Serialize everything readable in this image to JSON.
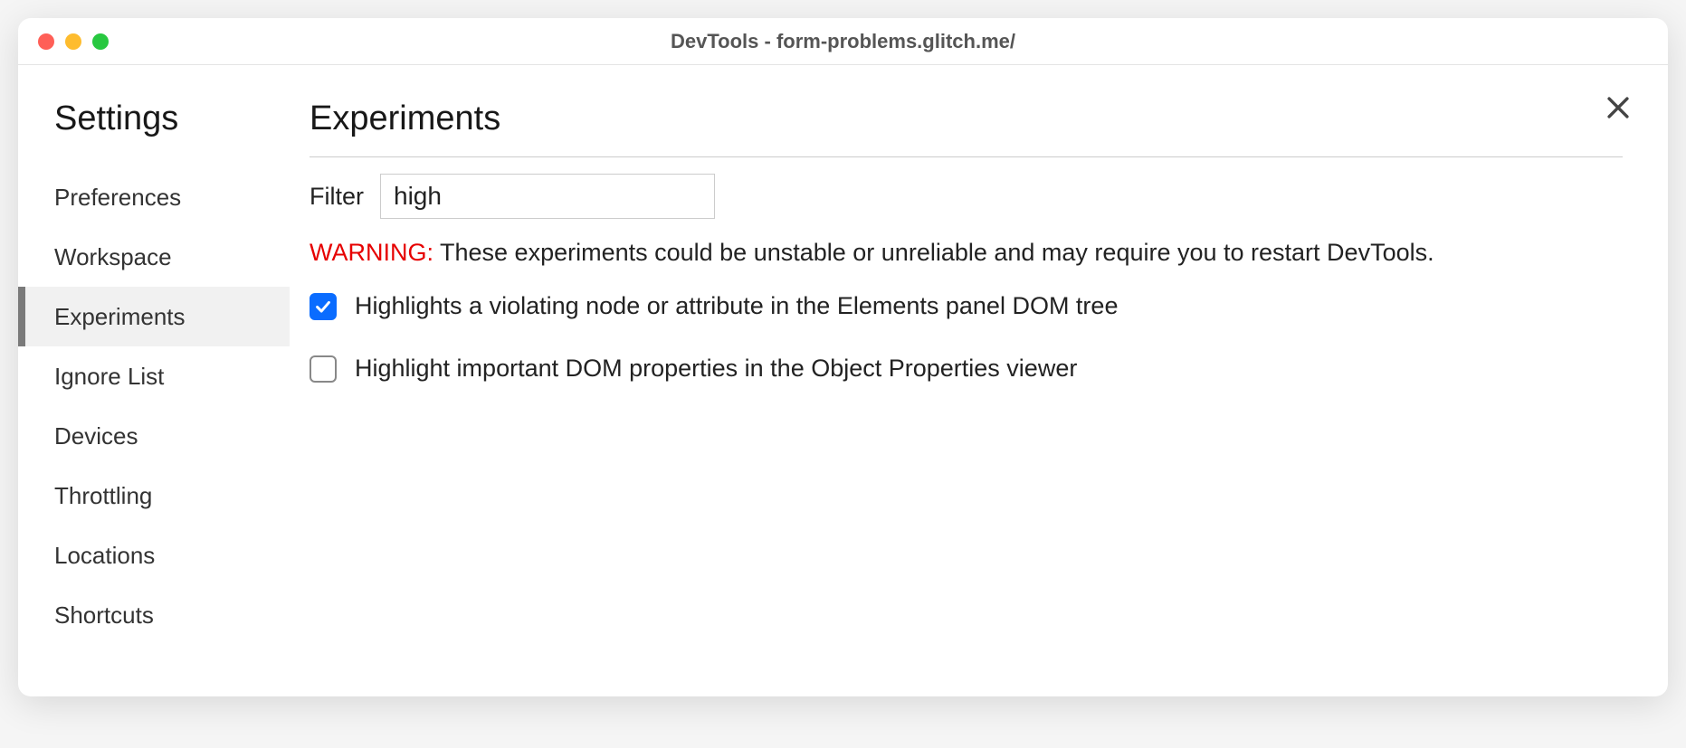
{
  "window": {
    "title": "DevTools - form-problems.glitch.me/"
  },
  "sidebar": {
    "title": "Settings",
    "items": [
      {
        "label": "Preferences",
        "active": false
      },
      {
        "label": "Workspace",
        "active": false
      },
      {
        "label": "Experiments",
        "active": true
      },
      {
        "label": "Ignore List",
        "active": false
      },
      {
        "label": "Devices",
        "active": false
      },
      {
        "label": "Throttling",
        "active": false
      },
      {
        "label": "Locations",
        "active": false
      },
      {
        "label": "Shortcuts",
        "active": false
      }
    ]
  },
  "main": {
    "title": "Experiments",
    "filter_label": "Filter",
    "filter_value": "high",
    "warning_label": "WARNING:",
    "warning_text": " These experiments could be unstable or unreliable and may require you to restart DevTools.",
    "experiments": [
      {
        "label": "Highlights a violating node or attribute in the Elements panel DOM tree",
        "checked": true
      },
      {
        "label": "Highlight important DOM properties in the Object Properties viewer",
        "checked": false
      }
    ]
  }
}
